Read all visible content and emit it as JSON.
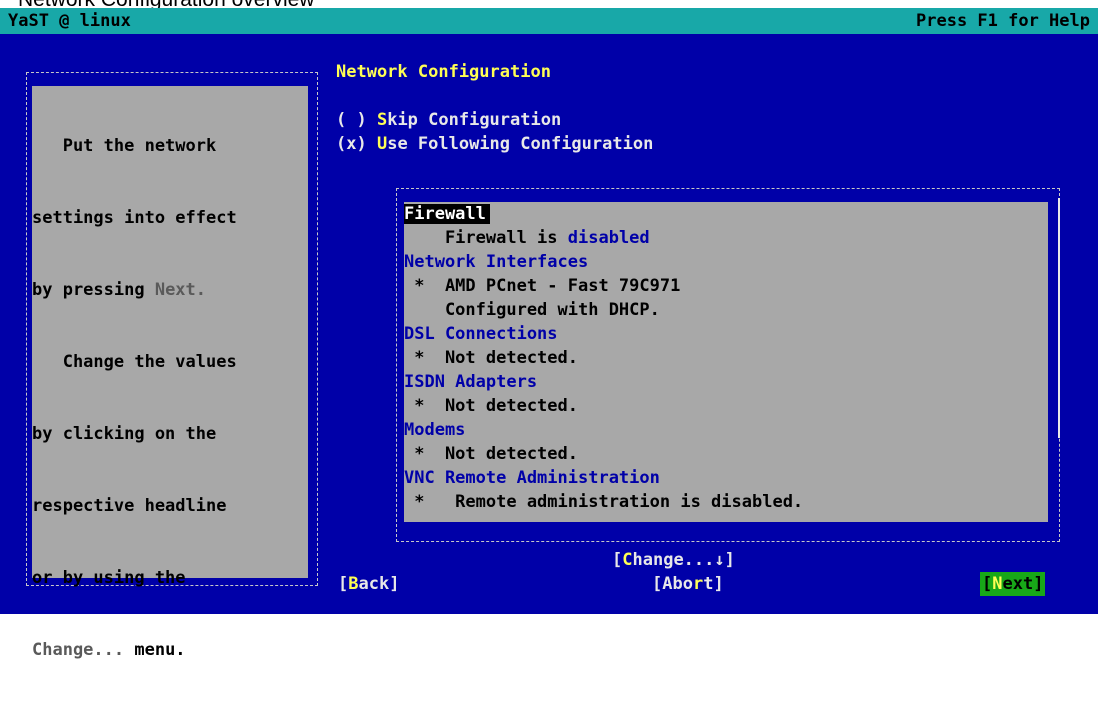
{
  "caption": "Network Configuration overview",
  "topbar": {
    "left": "YaST @ linux",
    "right": "Press F1 for Help"
  },
  "help": {
    "lines": [
      "   Put the network",
      "settings into effect",
      "by pressing ",
      "   Change the values",
      "by clicking on the",
      "respective headline",
      "or by using the",
      " menu."
    ],
    "next_word": "Next.",
    "change_word": "Change..."
  },
  "dialog": {
    "title": "Network Configuration",
    "skip": {
      "prefix": "( ) ",
      "hot": "S",
      "rest": "kip Configuration"
    },
    "use": {
      "prefix": "(x) ",
      "hot": "U",
      "rest": "se Following Configuration"
    }
  },
  "overview": {
    "firewall_head": "Firewall",
    "firewall_text": "    Firewall is ",
    "firewall_status": "disabled",
    "net_head": "Network Interfaces",
    "net_item": " *  AMD PCnet - Fast 79C971",
    "net_item2": "    Configured with DHCP.",
    "dsl_head": "DSL Connections",
    "dsl_item": " *  Not detected.",
    "isdn_head": "ISDN Adapters",
    "isdn_item": " *  Not detected.",
    "modem_head": "Modems",
    "modem_item": " *  Not detected.",
    "vnc_head": "VNC Remote Administration",
    "vnc_item": " *   Remote administration is disabled."
  },
  "buttons": {
    "change": {
      "open": "[",
      "hot": "C",
      "rest": "hange...↓]"
    },
    "back": {
      "open": "[",
      "hot": "B",
      "rest": "ack]"
    },
    "abort": {
      "open": "[Abo",
      "hot": "r",
      "rest": "t]"
    },
    "next": {
      "open": "[",
      "hot": "N",
      "rest": "ext]"
    }
  }
}
